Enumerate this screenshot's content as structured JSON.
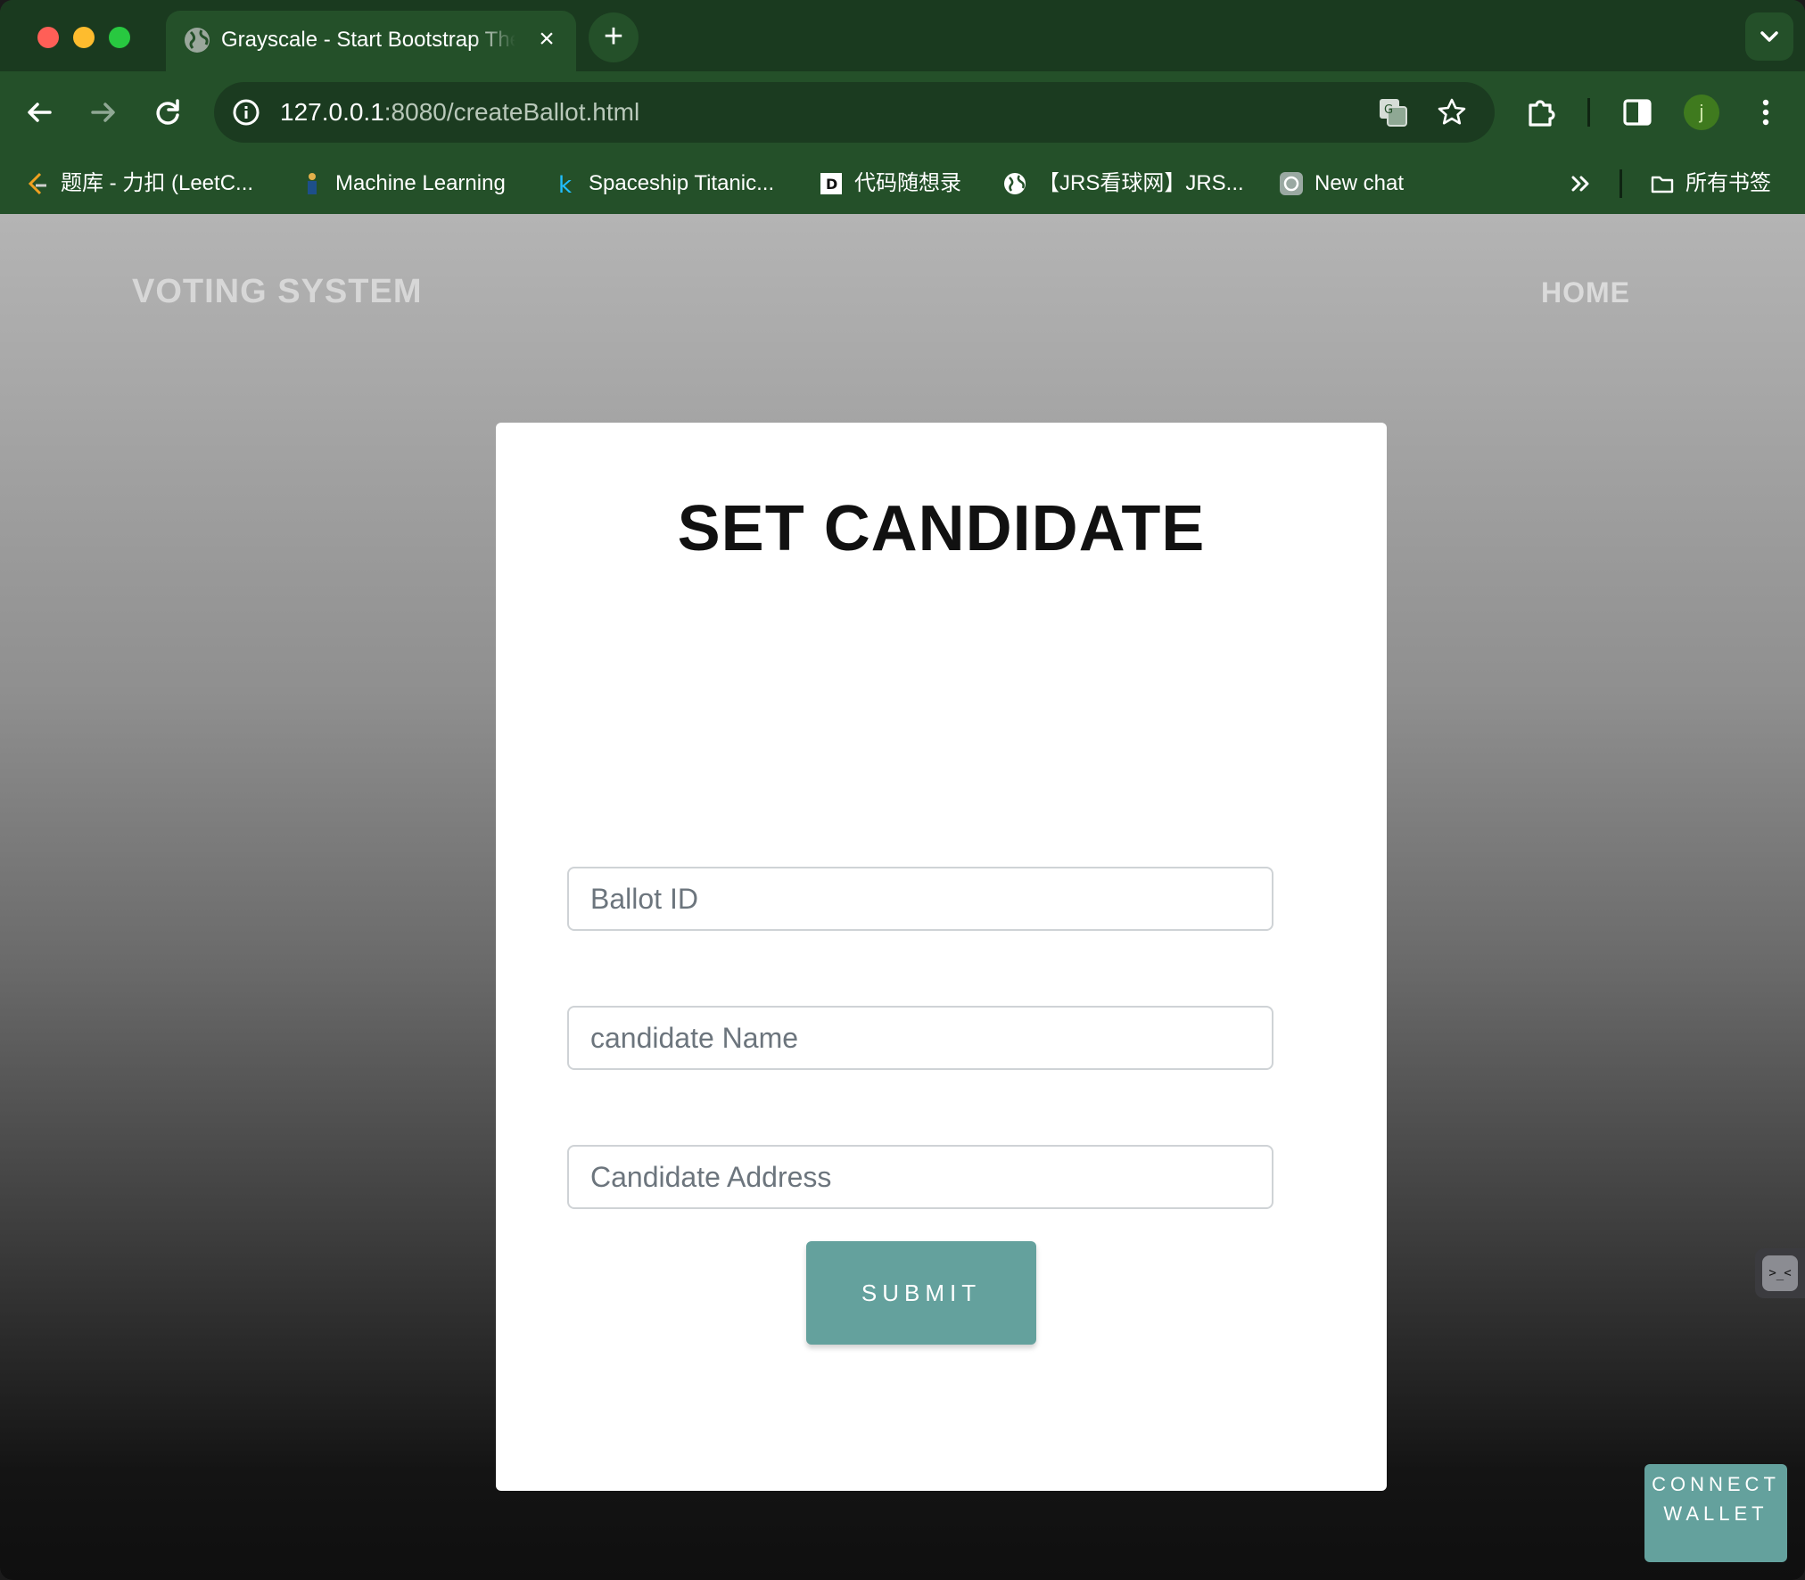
{
  "browser": {
    "tab_title": "Grayscale - Start Bootstrap Theme",
    "url_host": "127.0.0.1",
    "url_rest": ":8080/createBallot.html",
    "profile_initial": "j",
    "bookmarks": [
      {
        "label": "题库 - 力扣 (LeetC...",
        "icon": "leetcode-icon"
      },
      {
        "label": "Machine Learning",
        "icon": "ml-icon"
      },
      {
        "label": "Spaceship Titanic...",
        "icon": "kaggle-icon"
      },
      {
        "label": "代码随想录",
        "icon": "daima-icon"
      },
      {
        "label": "【JRS看球网】JRS...",
        "icon": "globe-icon"
      },
      {
        "label": "New chat",
        "icon": "chatgpt-icon"
      }
    ],
    "all_bookmarks_label": "所有书签"
  },
  "nav": {
    "brand": "VOTING SYSTEM",
    "home": "HOME"
  },
  "form": {
    "title": "SET CANDIDATE",
    "ballot_id_placeholder": "Ballot ID",
    "candidate_name_placeholder": "candidate Name",
    "candidate_address_placeholder": "Candidate Address",
    "submit_label": "SUBMIT"
  },
  "connect_wallet_label": "CONNECT WALLET",
  "colors": {
    "browser_frame": "#245029",
    "accent_teal": "#64a19d",
    "card_bg": "#ffffff"
  }
}
